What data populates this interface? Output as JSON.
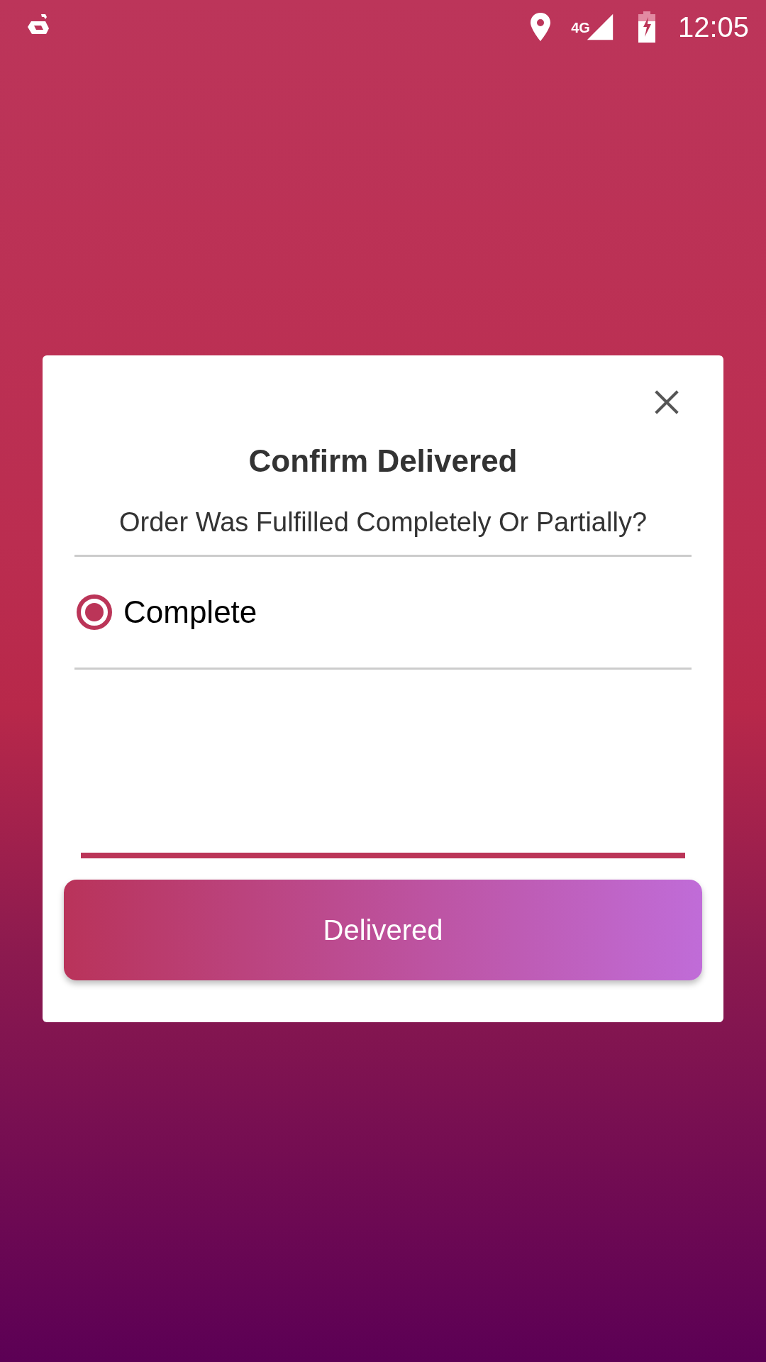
{
  "status_bar": {
    "network": "4G",
    "time": "12:05"
  },
  "dialog": {
    "title": "Confirm Delivered",
    "question": "Order Was Fulfilled Completely Or Partially?",
    "options": [
      {
        "label": "Complete",
        "selected": true
      }
    ],
    "button": "Delivered"
  }
}
